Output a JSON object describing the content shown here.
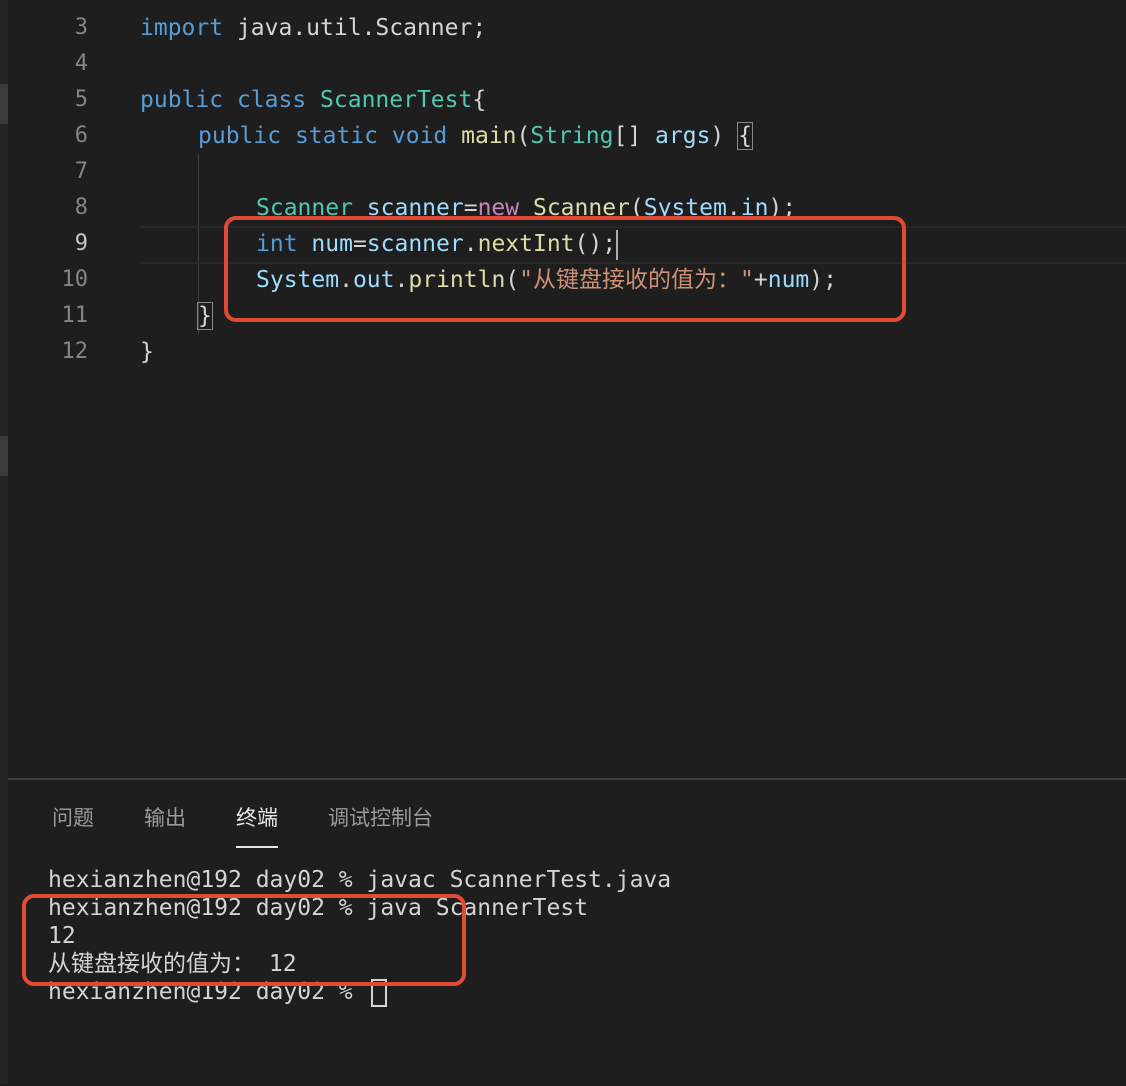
{
  "editor": {
    "lines": [
      {
        "no": "3"
      },
      {
        "no": "4"
      },
      {
        "no": "5"
      },
      {
        "no": "6"
      },
      {
        "no": "7"
      },
      {
        "no": "8"
      },
      {
        "no": "9"
      },
      {
        "no": "10"
      },
      {
        "no": "11"
      },
      {
        "no": "12"
      }
    ],
    "tokens": {
      "l3_import": "import",
      "l3_rest": " java.util.Scanner;",
      "l5_public": "public",
      "l5_class": " class ",
      "l5_name": "ScannerTest",
      "l5_brace": "{",
      "l6_public": "public",
      "l6_static": " static",
      "l6_void": " void",
      "l6_main": " main",
      "l6_paren": "(",
      "l6_string": "String",
      "l6_arr": "[] ",
      "l6_args": "args",
      "l6_close": ") ",
      "l6_brace": "{",
      "l8_scanner": "Scanner",
      "l8_var": " scanner",
      "l8_eq": "=",
      "l8_new": "new",
      "l8_ctor": " Scanner",
      "l8_paren": "(",
      "l8_system": "System",
      "l8_dot": ".",
      "l8_in": "in",
      "l8_end": ");",
      "l9_int": "int",
      "l9_num": " num",
      "l9_eq": "=",
      "l9_scanner": "scanner",
      "l9_dot": ".",
      "l9_next": "nextInt",
      "l9_end": "();",
      "l10_system": "System",
      "l10_dot1": ".",
      "l10_out": "out",
      "l10_dot2": ".",
      "l10_println": "println",
      "l10_paren": "(",
      "l10_str": "\"从键盘接收的值为：\"",
      "l10_plus": "+",
      "l10_num": "num",
      "l10_end": ");",
      "l11_brace": "}",
      "l12_brace": "}"
    }
  },
  "panel": {
    "tabs": [
      {
        "label": "问题"
      },
      {
        "label": "输出"
      },
      {
        "label": "终端",
        "active": true
      },
      {
        "label": "调试控制台"
      }
    ]
  },
  "terminal": {
    "lines": [
      "hexianzhen@192 day02 % javac ScannerTest.java",
      "hexianzhen@192 day02 % java ScannerTest",
      "12",
      "从键盘接收的值为： 12",
      "hexianzhen@192 day02 % "
    ]
  },
  "colors": {
    "annotation": "#e24a35",
    "keyword": "#569cd6",
    "type": "#4ec9b0",
    "function": "#dcdcaa",
    "variable": "#9cdcfe",
    "string": "#ce9178"
  }
}
